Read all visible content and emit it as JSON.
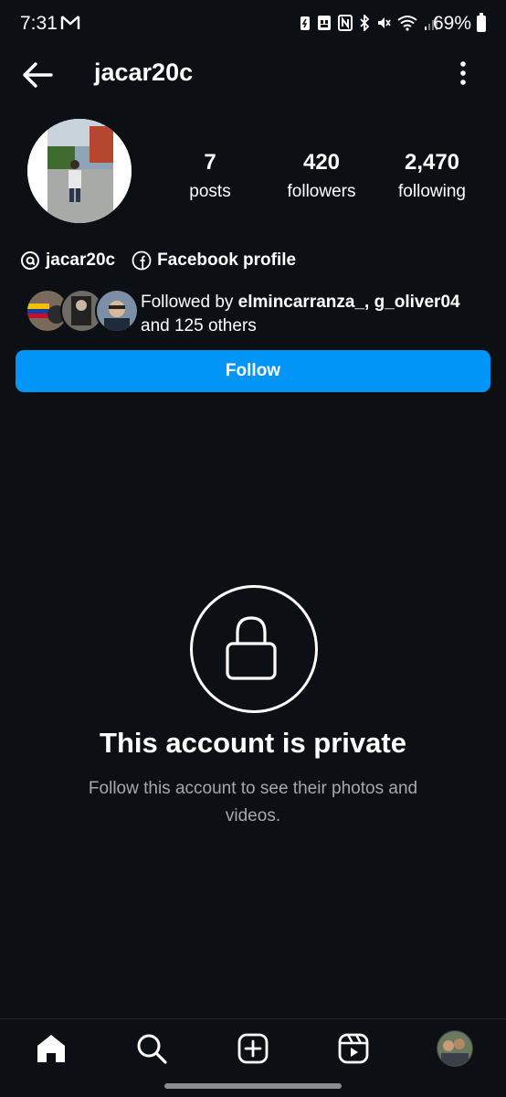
{
  "status_bar": {
    "time": "7:31",
    "battery": "69%",
    "icons": [
      "gmail-icon",
      "battery-saver-icon",
      "sim-icon",
      "nfc-icon",
      "bluetooth-icon",
      "mute-icon",
      "wifi-icon",
      "signal-icon"
    ]
  },
  "header": {
    "username": "jacar20c"
  },
  "profile": {
    "stats": {
      "posts_count": "7",
      "posts_label": "posts",
      "followers_count": "420",
      "followers_label": "followers",
      "following_count": "2,470",
      "following_label": "following"
    },
    "threads_handle": "jacar20c",
    "facebook_label": "Facebook profile",
    "followed_by": {
      "prefix": "Followed by ",
      "names": "elmincarranza_, g_oliver04",
      "suffix": "and 125 others"
    },
    "follow_button": "Follow"
  },
  "private": {
    "title": "This account is private",
    "subtitle": "Follow this account to see their photos and videos."
  },
  "nav": {
    "items": [
      "home-icon",
      "search-icon",
      "create-icon",
      "reels-icon",
      "profile-avatar"
    ]
  },
  "colors": {
    "background": "#0c1014",
    "accent": "#0095f6",
    "secondary_text": "#a8a8a8"
  }
}
